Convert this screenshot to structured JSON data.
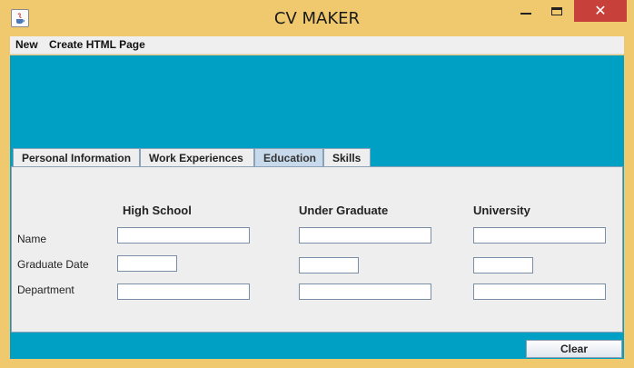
{
  "window": {
    "title": "CV MAKER",
    "close_glyph": "✕",
    "frame_color": "#f0c86e",
    "close_color": "#c7403a",
    "icon": "java-icon"
  },
  "menu": {
    "items": [
      "New",
      "Create HTML Page"
    ]
  },
  "content_bg": "#00a0c4",
  "tabs": [
    "Personal Information",
    "Work Experiences",
    "Education",
    "Skills"
  ],
  "active_tab": "Education",
  "education": {
    "columns": [
      "High School",
      "Under Graduate",
      "University"
    ],
    "rows": [
      "Name",
      "Graduate Date",
      "Department"
    ],
    "values": {
      "high_school": {
        "name": "",
        "graduate_date": "",
        "department": ""
      },
      "under_graduate": {
        "name": "",
        "graduate_date": "",
        "department": ""
      },
      "university": {
        "name": "",
        "graduate_date": "",
        "department": ""
      }
    }
  },
  "buttons": {
    "clear": "Clear"
  }
}
